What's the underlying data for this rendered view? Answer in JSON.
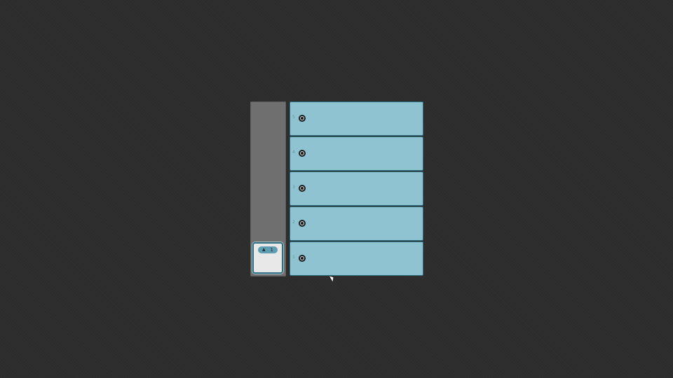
{
  "token": {
    "arrow": "▲",
    "count": "1"
  },
  "rows": [
    {
      "index": "5"
    },
    {
      "index": "4"
    },
    {
      "index": "3"
    },
    {
      "index": "2"
    },
    {
      "index": "1"
    }
  ],
  "colors": {
    "background": "#2c2c2c",
    "rack": "#6f6f6f",
    "row_fill": "#8fc3d2",
    "row_border": "#2f6f82",
    "token_pill": "#5f9db0"
  }
}
